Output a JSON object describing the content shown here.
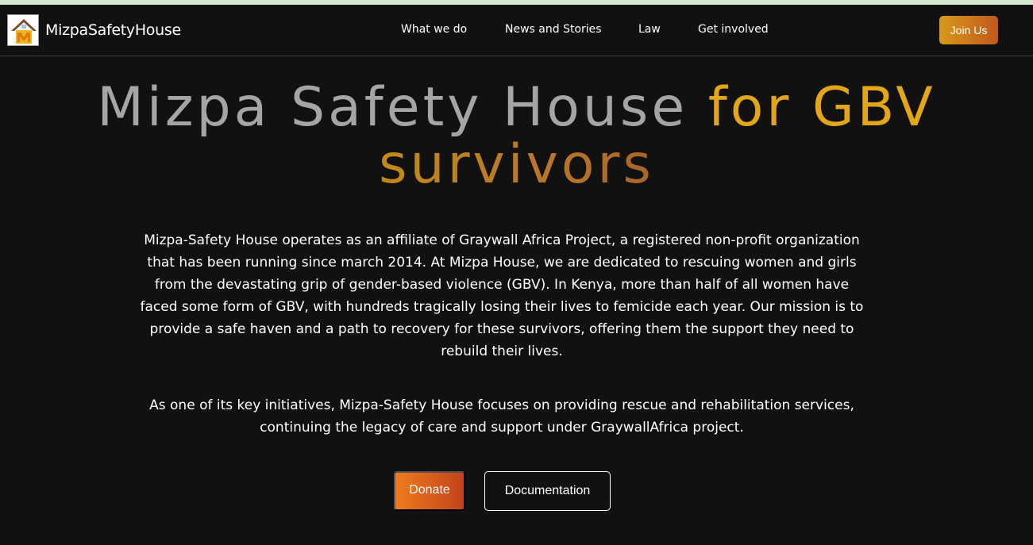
{
  "brand": {
    "name": "MizpaSafetyHouse",
    "logo_icon": "house-logo-icon"
  },
  "nav": {
    "items": [
      {
        "label": "What we do"
      },
      {
        "label": "News and Stories"
      },
      {
        "label": "Law"
      },
      {
        "label": "Get involved"
      }
    ],
    "join_label": "Join Us"
  },
  "hero": {
    "title_part1": "Mizpa Safety House",
    "title_part2": "for GBV",
    "title_part3": "survivors",
    "paragraph1": "Mizpa-Safety House operates as an affiliate of Graywall Africa Project, a registered non-profit organization that has been running since march 2014. At Mizpa House, we are dedicated to rescuing women and girls from the devastating grip of gender-based violence (GBV). In Kenya, more than half of all women have faced some form of GBV, with hundreds tragically losing their lives to femicide each year. Our mission is to provide a safe haven and a path to recovery for these survivors, offering them the support they need to rebuild their lives.",
    "paragraph2": "As one of its key initiatives, Mizpa-Safety House focuses on providing rescue and rehabilitation services, continuing the legacy of care and support under GraywallAfrica project."
  },
  "actions": {
    "donate_label": "Donate",
    "documentation_label": "Documentation"
  },
  "colors": {
    "background": "#111111",
    "accent_gold": "#e3a617",
    "accent_orange": "#f07a1e",
    "title_gray": "#a5a5a5",
    "top_strip": "#d4e8d0"
  }
}
